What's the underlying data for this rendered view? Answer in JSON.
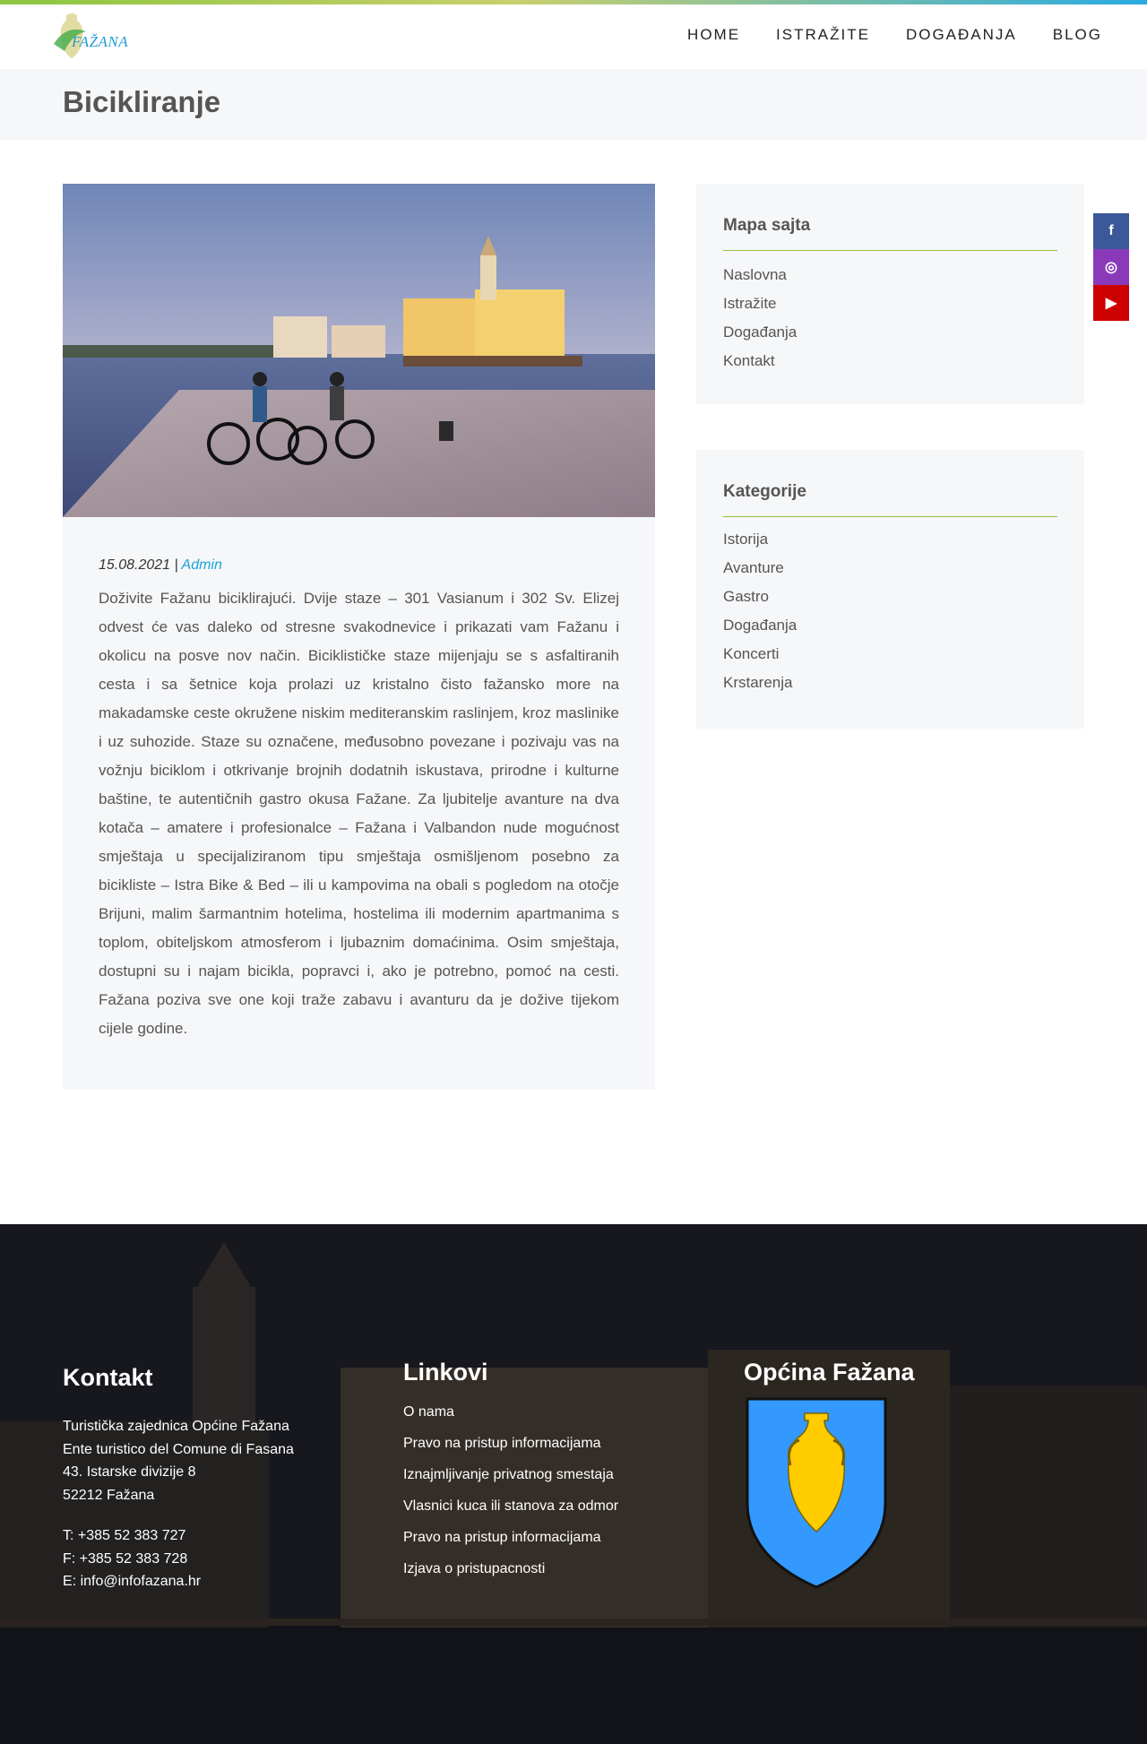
{
  "header": {
    "logo_text": "FAŽANA",
    "nav": [
      {
        "label": "HOME"
      },
      {
        "label": "ISTRAŽITE"
      },
      {
        "label": "DOGAĐANJA"
      },
      {
        "label": "BLOG"
      }
    ]
  },
  "page": {
    "title": "Bicikliranje"
  },
  "post": {
    "date": "15.08.2021 | ",
    "author": "Admin",
    "body": "Doživite Fažanu biciklirajući. Dvije staze – 301 Vasianum i 302 Sv. Elizej odvest će vas daleko od stresne svakodnevice i prikazati vam Fažanu i okolicu na posve nov način. Biciklističke staze mijenjaju se s asfaltiranih cesta i sa šetnice koja prolazi uz kristalno čisto fažansko more na makadamske ceste okružene niskim mediteranskim raslinjem, kroz maslinike i uz suhozide. Staze su označene, međusobno povezane i pozivaju vas na vožnju biciklom i otkrivanje brojnih dodatnih iskustava, prirodne i kulturne baštine, te autentičnih gastro okusa Fažane. Za ljubitelje avanture na dva kotača – amatere i profesionalce – Fažana i Valbandon nude mogućnost smještaja u specijaliziranom tipu smještaja osmišljenom posebno za bicikliste – Istra Bike & Bed – ili u kampovima na obali s pogledom na otočje Brijuni, malim šarmantnim hotelima, hostelima ili modernim apartmanima s toplom, obiteljskom atmosferom i ljubaznim domaćinima. Osim smještaja, dostupni su i najam bicikla, popravci i, ako je potrebno, pomoć na cesti. Fažana poziva sve one koji traže zabavu i avanturu da je dožive tijekom cijele godine."
  },
  "sidebar": {
    "sitemap": {
      "title": "Mapa sajta",
      "items": [
        "Naslovna",
        "Istražite",
        "Događanja",
        "Kontakt"
      ]
    },
    "categories": {
      "title": "Kategorije",
      "items": [
        "Istorija",
        "Avanture",
        "Gastro",
        "Događanja",
        "Koncerti",
        "Krstarenja"
      ]
    }
  },
  "social": [
    {
      "icon": "facebook-icon",
      "glyph": "f",
      "color": "#3b5998"
    },
    {
      "icon": "instagram-icon",
      "glyph": "◎",
      "color": "#8a3ab9"
    },
    {
      "icon": "youtube-icon",
      "glyph": "▶",
      "color": "#cc0000"
    }
  ],
  "footer": {
    "contact": {
      "title": "Kontakt",
      "lines": [
        "Turistička zajednica Općine Fažana",
        "Ente turistico del Comune di Fasana",
        "43. Istarske divizije 8",
        "52212 Fažana"
      ],
      "phone": "T: +385 52 383 727",
      "fax": "F: +385 52 383 728",
      "email": "E: info@infofazana.hr"
    },
    "links": {
      "title": "Linkovi",
      "items": [
        "O nama",
        "Pravo na pristup informacijama",
        "Iznajmljivanje privatnog smestaja",
        "Vlasnici kuca ili stanova za odmor",
        "Pravo na pristup informacijama",
        "Izjava o pristupacnosti"
      ]
    },
    "municipality": {
      "title": "Općina Fažana"
    }
  },
  "colors": {
    "accent_green": "#8cc63f",
    "accent_blue": "#1aa3d9",
    "crest_blue": "#3399ff",
    "crest_gold": "#ffcc00"
  }
}
